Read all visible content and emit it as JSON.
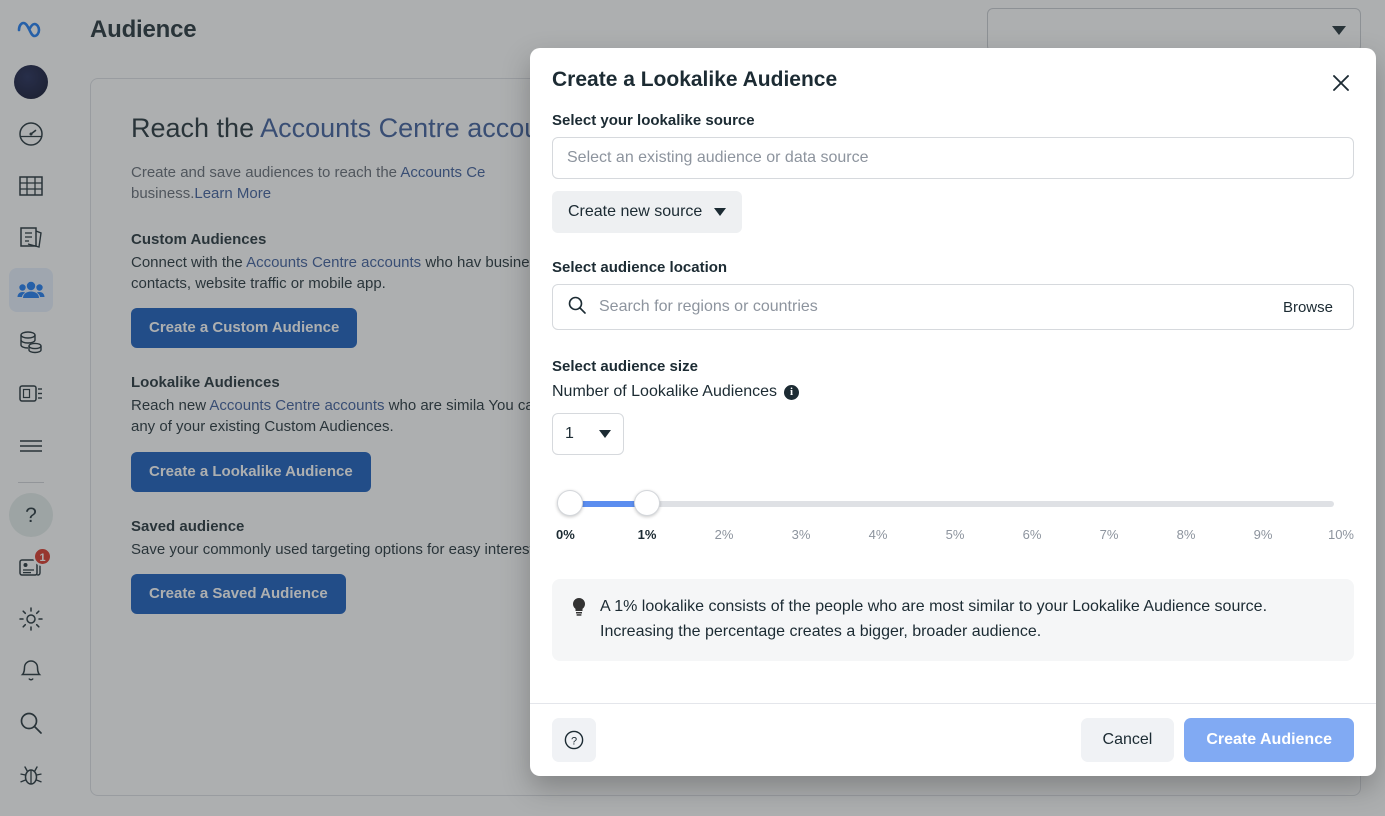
{
  "rail": {
    "items": [
      {
        "name": "meta-logo",
        "label": "Meta"
      },
      {
        "name": "account-avatar",
        "label": "Account"
      },
      {
        "name": "performance-icon",
        "label": "Performance"
      },
      {
        "name": "table-icon",
        "label": "Table"
      },
      {
        "name": "pages-icon",
        "label": "Pages"
      },
      {
        "name": "audiences-icon",
        "label": "Audiences"
      },
      {
        "name": "billing-coins-icon",
        "label": "Billing"
      },
      {
        "name": "events-manager-icon",
        "label": "Events Manager"
      },
      {
        "name": "all-tools-icon",
        "label": "All tools"
      },
      {
        "name": "help-icon",
        "label": "Help"
      },
      {
        "name": "news-icon",
        "label": "News",
        "badge": "1"
      },
      {
        "name": "settings-gear-icon",
        "label": "Settings"
      },
      {
        "name": "notifications-bell-icon",
        "label": "Notifications"
      },
      {
        "name": "search-icon",
        "label": "Search"
      },
      {
        "name": "bug-report-icon",
        "label": "Report a bug"
      }
    ]
  },
  "header": {
    "title": "Audience",
    "account_select_value": ""
  },
  "card": {
    "heading_prefix": "Reach the ",
    "heading_link": "Accounts Centre accounts",
    "lead_part1": "Create and save audiences to reach the ",
    "lead_link": "Accounts Ce",
    "lead_part2": "business.",
    "learn_more": "Learn More",
    "sections": [
      {
        "title": "Custom Audiences",
        "body_pre": "Connect with the ",
        "body_link": "Accounts Centre accounts",
        "body_post": " who hav business or product with Custom Audiences. You car contacts, website traffic or mobile app.",
        "button": "Create a Custom Audience"
      },
      {
        "title": "Lookalike Audiences",
        "body_pre": "Reach new ",
        "body_link": "Accounts Centre accounts",
        "body_post": " who are simila You can create a Lookalike Audience based on peopl any of your existing Custom Audiences.",
        "button": "Create a Lookalike Audience"
      },
      {
        "title": "Saved audience",
        "body_pre": "",
        "body_link": "",
        "body_post": "Save your commonly used targeting options for easy interests and behaviours, then save them to reuse in t",
        "button": "Create a Saved Audience"
      }
    ]
  },
  "modal": {
    "title": "Create a Lookalike Audience",
    "close_label": "Close",
    "source": {
      "label": "Select your lookalike source",
      "placeholder": "Select an existing audience or data source",
      "value": "",
      "create_button": "Create new source"
    },
    "location": {
      "label": "Select audience location",
      "placeholder": "Search for regions or countries",
      "value": "",
      "browse_button": "Browse"
    },
    "size": {
      "label": "Select audience size",
      "count_label": "Number of Lookalike Audiences",
      "count_value": "1",
      "slider": {
        "min": 0,
        "max": 10,
        "handle_low": 0,
        "handle_high": 1,
        "ticks": [
          "0%",
          "1%",
          "2%",
          "3%",
          "4%",
          "5%",
          "6%",
          "7%",
          "8%",
          "9%",
          "10%"
        ],
        "active_ticks": [
          0,
          1
        ],
        "fill_color": "#5b8def",
        "track_color": "#dfe1e5"
      }
    },
    "note": "A 1% lookalike consists of the people who are most similar to your Lookalike Audience source. Increasing the percentage creates a bigger, broader audience.",
    "footer": {
      "help_label": "Help",
      "cancel": "Cancel",
      "submit": "Create Audience"
    }
  }
}
